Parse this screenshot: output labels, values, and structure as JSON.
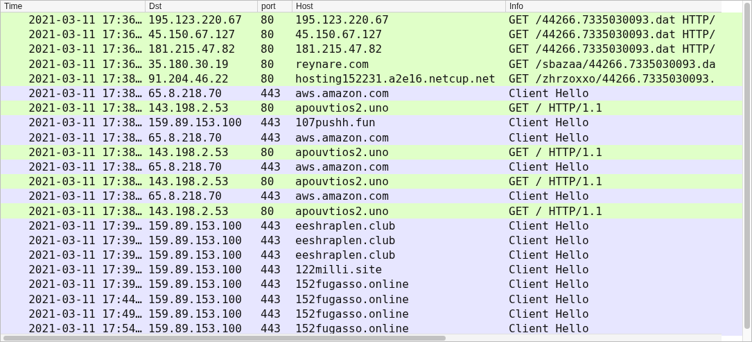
{
  "table": {
    "columns": [
      "Time",
      "Dst",
      "port",
      "Host",
      "Info"
    ],
    "rows": [
      {
        "cells": [
          "2021-03-11 17:36…",
          "195.123.220.67",
          "80",
          "195.123.220.67",
          "GET /44266.7335030093.dat HTTP/"
        ],
        "color": "#e0ffc8"
      },
      {
        "cells": [
          "2021-03-11 17:36…",
          "45.150.67.127",
          "80",
          "45.150.67.127",
          "GET /44266.7335030093.dat HTTP/"
        ],
        "color": "#e0ffc8"
      },
      {
        "cells": [
          "2021-03-11 17:36…",
          "181.215.47.82",
          "80",
          "181.215.47.82",
          "GET /44266.7335030093.dat HTTP/"
        ],
        "color": "#e0ffc8"
      },
      {
        "cells": [
          "2021-03-11 17:36…",
          "35.180.30.19",
          "80",
          "reynare.com",
          "GET /sbazaa/44266.7335030093.da"
        ],
        "color": "#e0ffc8"
      },
      {
        "cells": [
          "2021-03-11 17:38…",
          "91.204.46.22",
          "80",
          "hosting152231.a2e16.netcup.net",
          "GET /zhrzoxxo/44266.7335030093."
        ],
        "color": "#e0ffc8"
      },
      {
        "cells": [
          "2021-03-11 17:38…",
          "65.8.218.70",
          "443",
          "aws.amazon.com",
          "Client Hello"
        ],
        "color": "#e7e6ff"
      },
      {
        "cells": [
          "2021-03-11 17:38…",
          "143.198.2.53",
          "80",
          "apouvtios2.uno",
          "GET / HTTP/1.1"
        ],
        "color": "#e0ffc8"
      },
      {
        "cells": [
          "2021-03-11 17:38…",
          "159.89.153.100",
          "443",
          "107pushh.fun",
          "Client Hello"
        ],
        "color": "#e7e6ff"
      },
      {
        "cells": [
          "2021-03-11 17:38…",
          "65.8.218.70",
          "443",
          "aws.amazon.com",
          "Client Hello"
        ],
        "color": "#e7e6ff"
      },
      {
        "cells": [
          "2021-03-11 17:38…",
          "143.198.2.53",
          "80",
          "apouvtios2.uno",
          "GET / HTTP/1.1"
        ],
        "color": "#e0ffc8"
      },
      {
        "cells": [
          "2021-03-11 17:38…",
          "65.8.218.70",
          "443",
          "aws.amazon.com",
          "Client Hello"
        ],
        "color": "#e7e6ff"
      },
      {
        "cells": [
          "2021-03-11 17:38…",
          "143.198.2.53",
          "80",
          "apouvtios2.uno",
          "GET / HTTP/1.1"
        ],
        "color": "#e0ffc8"
      },
      {
        "cells": [
          "2021-03-11 17:38…",
          "65.8.218.70",
          "443",
          "aws.amazon.com",
          "Client Hello"
        ],
        "color": "#e7e6ff"
      },
      {
        "cells": [
          "2021-03-11 17:38…",
          "143.198.2.53",
          "80",
          "apouvtios2.uno",
          "GET / HTTP/1.1"
        ],
        "color": "#e0ffc8"
      },
      {
        "cells": [
          "2021-03-11 17:39…",
          "159.89.153.100",
          "443",
          "eeshraplen.club",
          "Client Hello"
        ],
        "color": "#e7e6ff"
      },
      {
        "cells": [
          "2021-03-11 17:39…",
          "159.89.153.100",
          "443",
          "eeshraplen.club",
          "Client Hello"
        ],
        "color": "#e7e6ff"
      },
      {
        "cells": [
          "2021-03-11 17:39…",
          "159.89.153.100",
          "443",
          "eeshraplen.club",
          "Client Hello"
        ],
        "color": "#e7e6ff"
      },
      {
        "cells": [
          "2021-03-11 17:39…",
          "159.89.153.100",
          "443",
          "122milli.site",
          "Client Hello"
        ],
        "color": "#e7e6ff"
      },
      {
        "cells": [
          "2021-03-11 17:39…",
          "159.89.153.100",
          "443",
          "152fugasso.online",
          "Client Hello"
        ],
        "color": "#e7e6ff"
      },
      {
        "cells": [
          "2021-03-11 17:44…",
          "159.89.153.100",
          "443",
          "152fugasso.online",
          "Client Hello"
        ],
        "color": "#e7e6ff"
      },
      {
        "cells": [
          "2021-03-11 17:49…",
          "159.89.153.100",
          "443",
          "152fugasso.online",
          "Client Hello"
        ],
        "color": "#e7e6ff"
      },
      {
        "cells": [
          "2021-03-11 17:54…",
          "159.89.153.100",
          "443",
          "152fugasso.online",
          "Client Hello"
        ],
        "color": "#e7e6ff"
      }
    ]
  }
}
